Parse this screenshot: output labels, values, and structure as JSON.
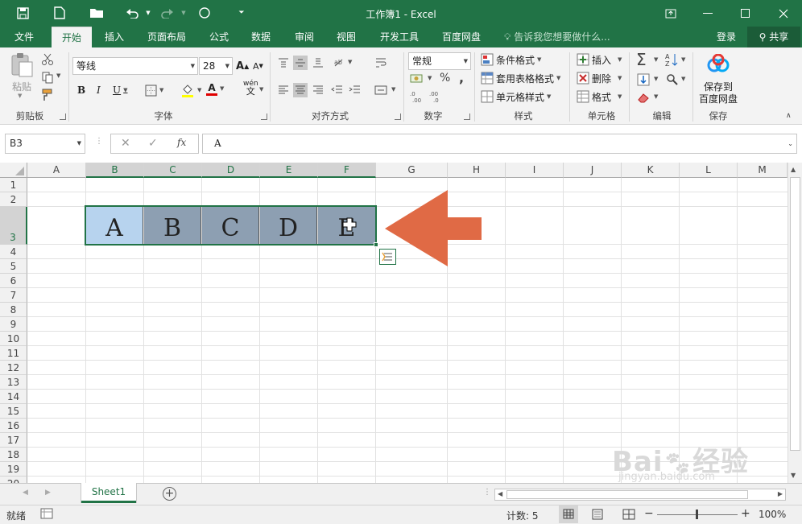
{
  "titlebar": {
    "title": "工作簿1 - Excel",
    "qa_icons": [
      "save-icon",
      "new-document-icon",
      "open-folder-icon",
      "undo-icon",
      "redo-icon",
      "touch-mode-icon",
      "customize-qa-icon"
    ]
  },
  "tabs": [
    "文件",
    "开始",
    "插入",
    "页面布局",
    "公式",
    "数据",
    "审阅",
    "视图",
    "开发工具",
    "百度网盘"
  ],
  "tell_me": "告诉我您想要做什么...",
  "login": "登录",
  "share": "共享",
  "ribbon": {
    "paste": "粘贴",
    "groups": [
      "剪贴板",
      "字体",
      "对齐方式",
      "数字",
      "样式",
      "单元格",
      "编辑",
      "保存"
    ],
    "font_name": "等线",
    "font_size": "28",
    "bold": "B",
    "italic": "I",
    "underline": "U",
    "font_color_letter": "A",
    "grow_font": "A",
    "shrink_font": "A",
    "phonetic": "wén",
    "number_format": "常规",
    "percent": "%",
    "comma": ",",
    "conditional_format": "条件格式",
    "table_format": "套用表格格式",
    "cell_styles": "单元格样式",
    "insert": "插入",
    "delete": "删除",
    "format": "格式",
    "save_to_baidu_1": "保存到",
    "save_to_baidu_2": "百度网盘"
  },
  "formula_bar": {
    "name_box": "B3",
    "formula": "A",
    "fx": "fx"
  },
  "sheet": {
    "columns": [
      "A",
      "B",
      "C",
      "D",
      "E",
      "F",
      "G",
      "H",
      "I",
      "J",
      "K",
      "L",
      "M"
    ],
    "rows": [
      "1",
      "2",
      "3",
      "4",
      "5",
      "6",
      "7",
      "8",
      "9",
      "10",
      "11",
      "12",
      "13",
      "14",
      "15",
      "16",
      "17",
      "18",
      "19",
      "20"
    ],
    "row3_values": [
      "A",
      "B",
      "C",
      "D",
      "E"
    ],
    "tab_name": "Sheet1"
  },
  "status": {
    "ready": "就绪",
    "count": "计数: 5",
    "zoom": "100%",
    "zoom_minus": "−",
    "zoom_plus": "+"
  },
  "colors": {
    "excel_green": "#217346",
    "selection_fill": "#8d9fb2",
    "active_cell_fill": "#b7d3ee",
    "arrow": "#e06a45"
  }
}
